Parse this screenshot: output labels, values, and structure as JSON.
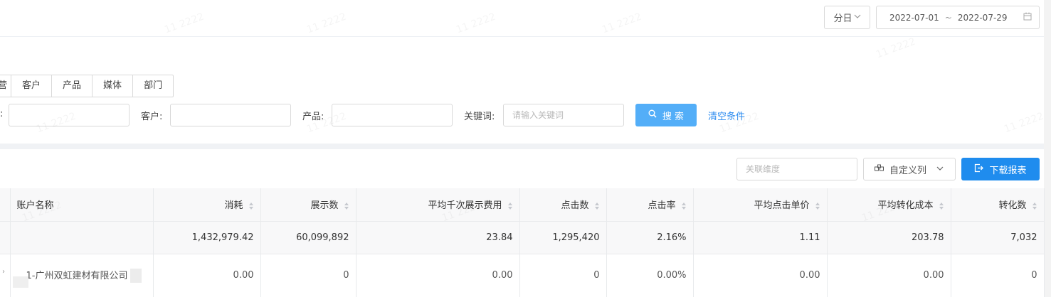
{
  "header": {
    "granularity_label": "分日",
    "date_start": "2022-07-01",
    "date_sep": "~",
    "date_end": "2022-07-29"
  },
  "dimension_tabs": [
    "营",
    "客户",
    "产品",
    "媒体",
    "部门"
  ],
  "filters": {
    "customer_label": "客户:",
    "product_label": "产品:",
    "keyword_label": "关键词:",
    "keyword_placeholder": "请输入关键词",
    "search_label": "搜 索",
    "clear_label": "清空条件"
  },
  "toolbar": {
    "relate_placeholder": "关联维度",
    "custom_columns_label": "自定义列",
    "download_label": "下载报表"
  },
  "table": {
    "columns": [
      "",
      "账户名称",
      "消耗",
      "展示数",
      "平均千次展示费用",
      "点击数",
      "点击率",
      "平均点击单价",
      "平均转化成本",
      "转化数"
    ],
    "total_row": [
      "",
      "",
      "1,432,979.42",
      "60,099,892",
      "23.84",
      "1,295,420",
      "2.16%",
      "1.11",
      "203.78",
      "7,032"
    ],
    "rows": [
      [
        "",
        "1-广州双虹建材有限公司",
        "0.00",
        "0",
        "0.00",
        "0",
        "0.00%",
        "0.00",
        "0.00",
        "0"
      ]
    ]
  },
  "watermark_text": "11 2222",
  "colors": {
    "primary": "#1f8cee",
    "search_button": "#53aef8",
    "link": "#2d8cf0",
    "header_bg": "#f8f8f9"
  }
}
